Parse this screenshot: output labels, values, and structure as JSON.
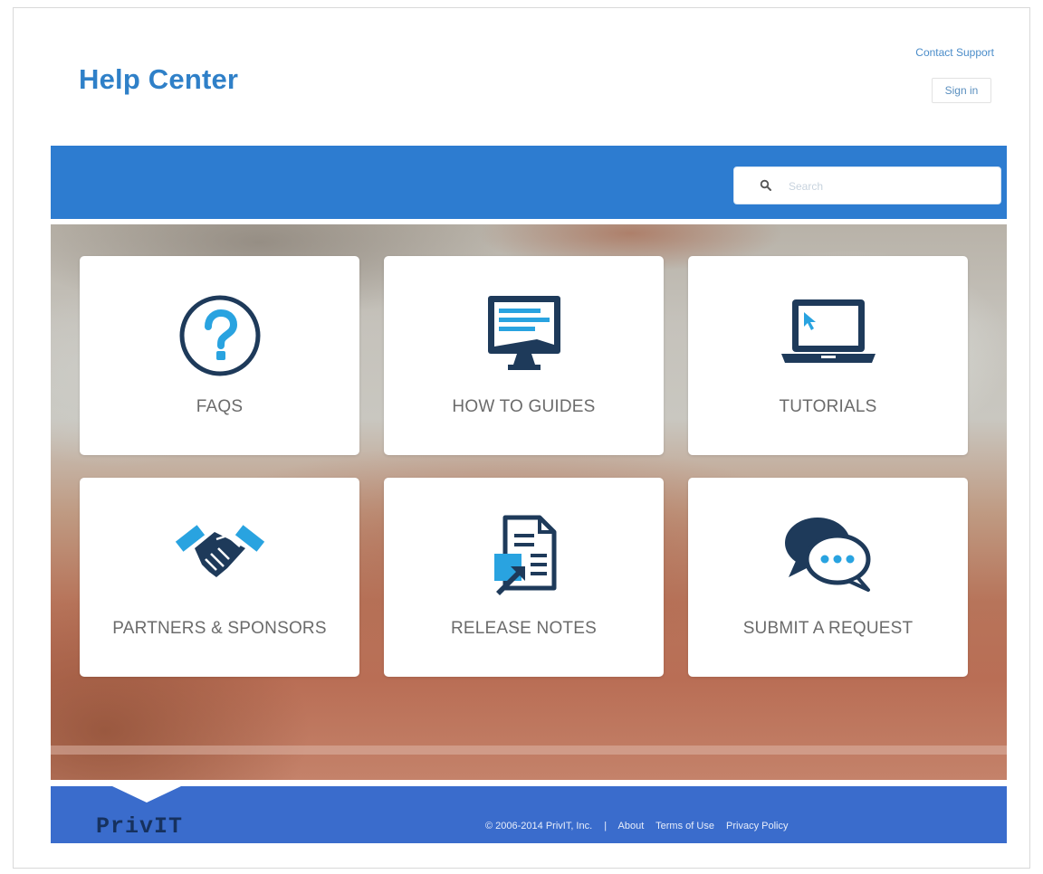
{
  "header": {
    "title": "Help Center",
    "contact_link": "Contact Support",
    "signin_label": "Sign in"
  },
  "search": {
    "placeholder": "Search"
  },
  "categories": [
    {
      "label": "FAQS",
      "icon": "question-circle-icon"
    },
    {
      "label": "HOW TO GUIDES",
      "icon": "monitor-document-icon"
    },
    {
      "label": "TUTORIALS",
      "icon": "laptop-cursor-icon"
    },
    {
      "label": "PARTNERS & SPONSORS",
      "icon": "handshake-icon"
    },
    {
      "label": "RELEASE NOTES",
      "icon": "document-arrow-icon"
    },
    {
      "label": "SUBMIT A REQUEST",
      "icon": "chat-bubbles-icon"
    }
  ],
  "footer": {
    "logo": "PrivIT",
    "copyright": "© 2006-2014 PrivIT, Inc.",
    "separator": "|",
    "links": [
      "About",
      "Terms of Use",
      "Privacy Policy"
    ]
  },
  "colors": {
    "brand_blue": "#2d7cd0",
    "footer_blue": "#3a6ccc",
    "icon_dark": "#1e3a5a",
    "icon_accent": "#29a3e0"
  }
}
